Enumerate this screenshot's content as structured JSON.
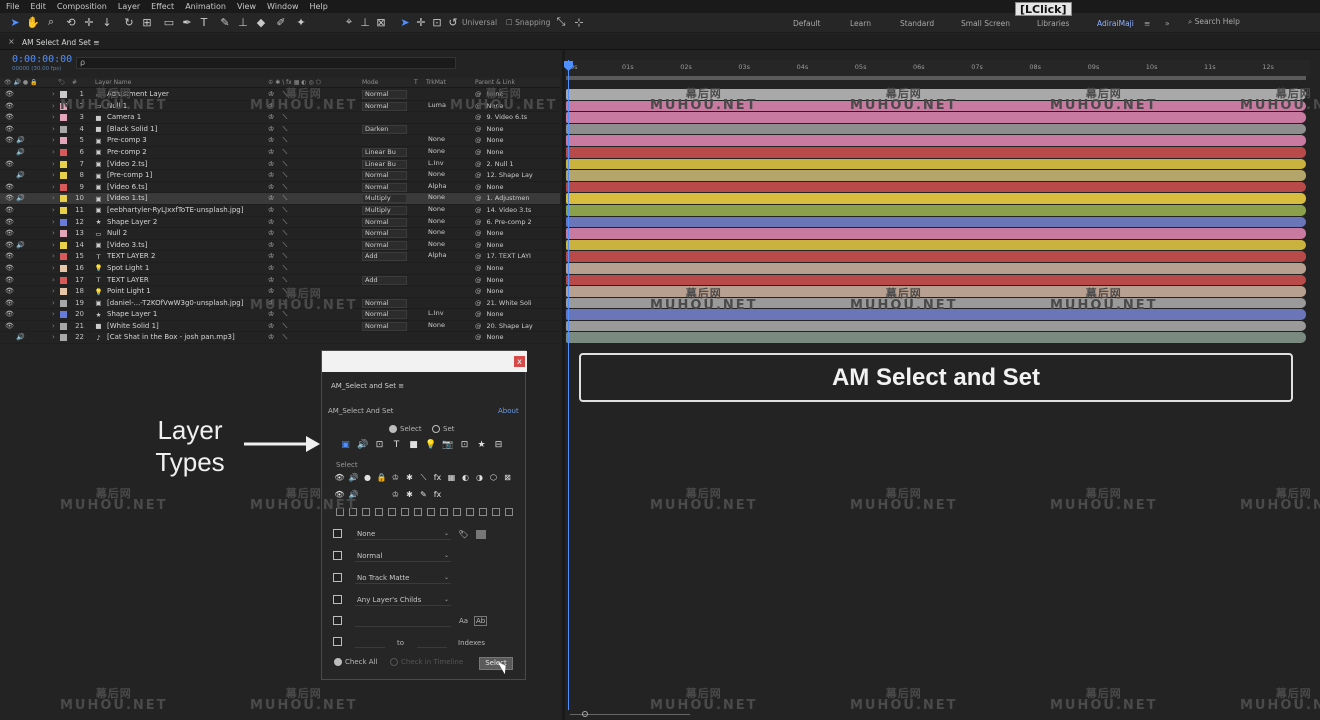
{
  "menu": [
    "File",
    "Edit",
    "Composition",
    "Layer",
    "Effect",
    "Animation",
    "View",
    "Window",
    "Help"
  ],
  "toolbar": {
    "universal": "Universal",
    "snapping": "Snapping",
    "workspaces": [
      "Default",
      "Learn",
      "Standard",
      "Small Screen",
      "Libraries",
      "AdiraiMaji"
    ],
    "lclick": "[LClick]",
    "search_help": "Search Help"
  },
  "comp_tab": "AM Select And Set",
  "timecode": "0:00:00:00",
  "timecode_sub": "00000 (30.00 fps)",
  "search_glyph": "ρ",
  "columns": {
    "layer_name": "Layer Name",
    "mode": "Mode",
    "t": "T",
    "trkmat": "TrkMat",
    "parent": "Parent & Link"
  },
  "layers": [
    {
      "num": "1",
      "name": "Adjustment Layer",
      "label": "#c9c9c9",
      "icon": "▭",
      "eye": "👁",
      "audio": "",
      "mode": "Normal",
      "trkmat": "",
      "parent_num": "",
      "parent": "None"
    },
    {
      "num": "2",
      "name": "Null 1",
      "label": "#e2a6b8",
      "icon": "▭",
      "eye": "👁",
      "audio": "",
      "mode": "Normal",
      "trkmat": "Luma",
      "parent_num": "",
      "parent": "None"
    },
    {
      "num": "3",
      "name": "Camera 1",
      "label": "#e2a6b8",
      "icon": "■",
      "eye": "👁",
      "audio": "",
      "mode": "",
      "trkmat": "",
      "parent_num": "",
      "parent": "9. Video 6.ts"
    },
    {
      "num": "4",
      "name": "[Black Solid 1]",
      "label": "#a8a8a8",
      "icon": "■",
      "eye": "👁",
      "audio": "",
      "mode": "Darken",
      "trkmat": "",
      "parent_num": "",
      "parent": "None"
    },
    {
      "num": "5",
      "name": "Pre-comp 3",
      "label": "#e2a6b8",
      "icon": "▣",
      "eye": "👁",
      "audio": "🔊",
      "mode": "",
      "trkmat": "None",
      "parent_num": "",
      "parent": "None"
    },
    {
      "num": "6",
      "name": "Pre-comp 2",
      "label": "#d65a5a",
      "icon": "▣",
      "eye": "",
      "audio": "🔊",
      "mode": "Linear Bu",
      "trkmat": "None",
      "parent_num": "",
      "parent": "None"
    },
    {
      "num": "7",
      "name": "[Video 2.ts]",
      "label": "#e8d04a",
      "icon": "▣",
      "eye": "👁",
      "audio": "",
      "mode": "Linear Bu",
      "trkmat": "L.Inv",
      "parent_num": "",
      "parent": "2. Null 1"
    },
    {
      "num": "8",
      "name": "[Pre-comp 1]",
      "label": "#e8d04a",
      "icon": "▣",
      "eye": "",
      "audio": "🔊",
      "mode": "Normal",
      "trkmat": "None",
      "parent_num": "",
      "parent": "12. Shape Lay"
    },
    {
      "num": "9",
      "name": "[Video 6.ts]",
      "label": "#d65a5a",
      "icon": "▣",
      "eye": "👁",
      "audio": "",
      "mode": "Normal",
      "trkmat": "Alpha",
      "parent_num": "",
      "parent": "None"
    },
    {
      "num": "10",
      "name": "[Video 1.ts]",
      "label": "#e8d04a",
      "icon": "▣",
      "eye": "👁",
      "audio": "🔊",
      "mode": "Multiply",
      "trkmat": "None",
      "parent_num": "",
      "parent": "1. Adjustmen",
      "selected": true
    },
    {
      "num": "11",
      "name": "[eebhartyler-RyLJxxfToTE-unsplash.jpg]",
      "label": "#e8d04a",
      "icon": "▣",
      "eye": "👁",
      "audio": "",
      "mode": "Multiply",
      "trkmat": "None",
      "parent_num": "",
      "parent": "14. Video 3.ts"
    },
    {
      "num": "12",
      "name": "Shape Layer 2",
      "label": "#6a7ad8",
      "icon": "★",
      "eye": "👁",
      "audio": "",
      "mode": "Normal",
      "trkmat": "None",
      "parent_num": "",
      "parent": "6. Pre-comp 2"
    },
    {
      "num": "13",
      "name": "Null 2",
      "label": "#e2a6b8",
      "icon": "▭",
      "eye": "👁",
      "audio": "",
      "mode": "Normal",
      "trkmat": "None",
      "parent_num": "",
      "parent": "None"
    },
    {
      "num": "14",
      "name": "[Video 3.ts]",
      "label": "#e8d04a",
      "icon": "▣",
      "eye": "👁",
      "audio": "🔊",
      "mode": "Normal",
      "trkmat": "None",
      "parent_num": "",
      "parent": "None"
    },
    {
      "num": "15",
      "name": "TEXT LAYER 2",
      "label": "#d65a5a",
      "icon": "T",
      "eye": "👁",
      "audio": "",
      "mode": "Add",
      "trkmat": "Alpha",
      "parent_num": "",
      "parent": "17. TEXT LAYI"
    },
    {
      "num": "16",
      "name": "Spot Light 1",
      "label": "#e6c6a8",
      "icon": "💡",
      "eye": "👁",
      "audio": "",
      "mode": "",
      "trkmat": "",
      "parent_num": "",
      "parent": "None"
    },
    {
      "num": "17",
      "name": "TEXT LAYER",
      "label": "#d65a5a",
      "icon": "T",
      "eye": "👁",
      "audio": "",
      "mode": "Add",
      "trkmat": "",
      "parent_num": "",
      "parent": "None"
    },
    {
      "num": "18",
      "name": "Point Light 1",
      "label": "#e6c6a8",
      "icon": "💡",
      "eye": "👁",
      "audio": "",
      "mode": "",
      "trkmat": "",
      "parent_num": "",
      "parent": "None"
    },
    {
      "num": "19",
      "name": "[daniel-...-T2KOfVwW3g0-unsplash.jpg]",
      "label": "#a8a8a8",
      "icon": "▣",
      "eye": "👁",
      "audio": "",
      "mode": "Normal",
      "trkmat": "",
      "parent_num": "",
      "parent": "21. White Soli"
    },
    {
      "num": "20",
      "name": "Shape Layer 1",
      "label": "#6a7ad8",
      "icon": "★",
      "eye": "👁",
      "audio": "",
      "mode": "Normal",
      "trkmat": "L.Inv",
      "parent_num": "",
      "parent": "None"
    },
    {
      "num": "21",
      "name": "[White Solid 1]",
      "label": "#a8a8a8",
      "icon": "■",
      "eye": "👁",
      "audio": "",
      "mode": "Normal",
      "trkmat": "None",
      "parent_num": "",
      "parent": "20. Shape Lay"
    },
    {
      "num": "22",
      "name": "[Cat Shat in the Box - josh pan.mp3]",
      "label": "#a8a8a8",
      "icon": "♪",
      "eye": "",
      "audio": "🔊",
      "mode": "",
      "trkmat": "",
      "parent_num": "",
      "parent": "None"
    }
  ],
  "track_colors": [
    "#a9a9a9",
    "#c97aa0",
    "#c97aa0",
    "#8e8e8e",
    "#c97aa0",
    "#b84a4a",
    "#c9b23e",
    "#b4a66a",
    "#b84a4a",
    "#d8bc3e",
    "#8aa04a",
    "#6a76b8",
    "#c97aa0",
    "#c9b23e",
    "#b84a4a",
    "#b8a090",
    "#b84a4a",
    "#b8a090",
    "#9a9a9a",
    "#6a76b8",
    "#9a9a9a",
    "#7a8a80"
  ],
  "ruler_ticks": [
    "0s",
    "01s",
    "02s",
    "03s",
    "04s",
    "05s",
    "06s",
    "07s",
    "08s",
    "09s",
    "10s",
    "11s",
    "12s"
  ],
  "title_card": "AM Select and Set",
  "annotation": {
    "line1": "Layer",
    "line2": "Types"
  },
  "panel": {
    "tab": "AM_Select and Set",
    "close": "x",
    "header": "AM_Select And Set",
    "about": "About",
    "mode_select": "Select",
    "mode_set": "Set",
    "select_label": "Select",
    "dropdown_label": "None",
    "dropdown_blend": "Normal",
    "dropdown_matte": "No Track Matte",
    "dropdown_parent": "Any Layer's Childs",
    "aa": "Aa",
    "to": "to",
    "indexes": "Indexes",
    "check_all": "Check All",
    "check_in_timeline": "Check in Timeline",
    "select_button": "Select"
  },
  "watermark": {
    "cn": "幕后网",
    "en": "MUHOU.NET"
  }
}
